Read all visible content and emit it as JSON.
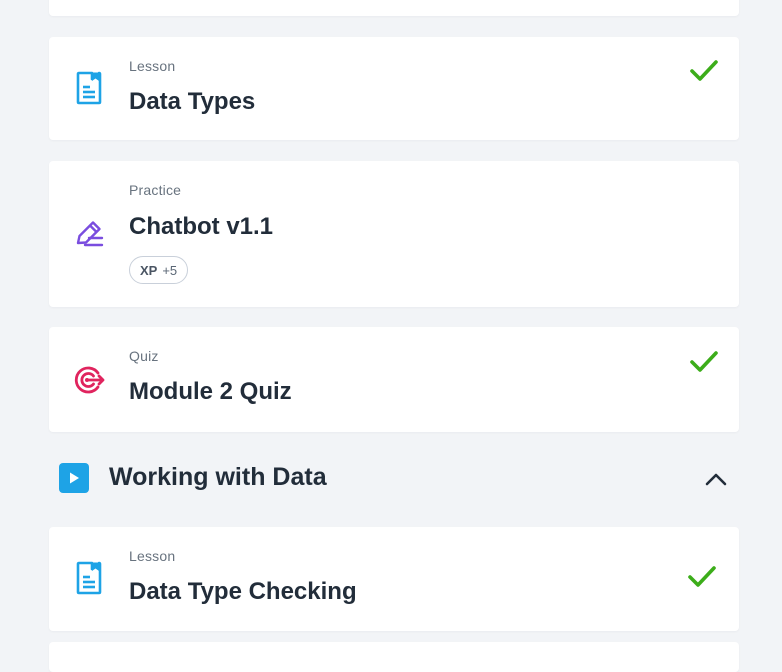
{
  "cards": [
    {
      "kind": "Lesson",
      "title": "Data Types",
      "icon": "lesson-doc-icon",
      "completed": true
    },
    {
      "kind": "Practice",
      "title": "Chatbot v1.1",
      "icon": "pencil-practice-icon",
      "completed": false,
      "xp": {
        "label": "XP",
        "value": "+5"
      }
    },
    {
      "kind": "Quiz",
      "title": "Module 2 Quiz",
      "icon": "target-quiz-icon",
      "completed": true
    }
  ],
  "section": {
    "title": "Working with Data",
    "icon": "play-icon",
    "expanded": true
  },
  "section_cards": [
    {
      "kind": "Lesson",
      "title": "Data Type Checking",
      "icon": "lesson-doc-icon",
      "completed": true
    }
  ],
  "colors": {
    "background": "#f2f4f7",
    "check": "#3cad1a",
    "lesson_icon": "#1ea3e6",
    "practice_icon": "#7a4ddf",
    "quiz_icon": "#e0245e",
    "section_icon": "#1ea3e6"
  }
}
